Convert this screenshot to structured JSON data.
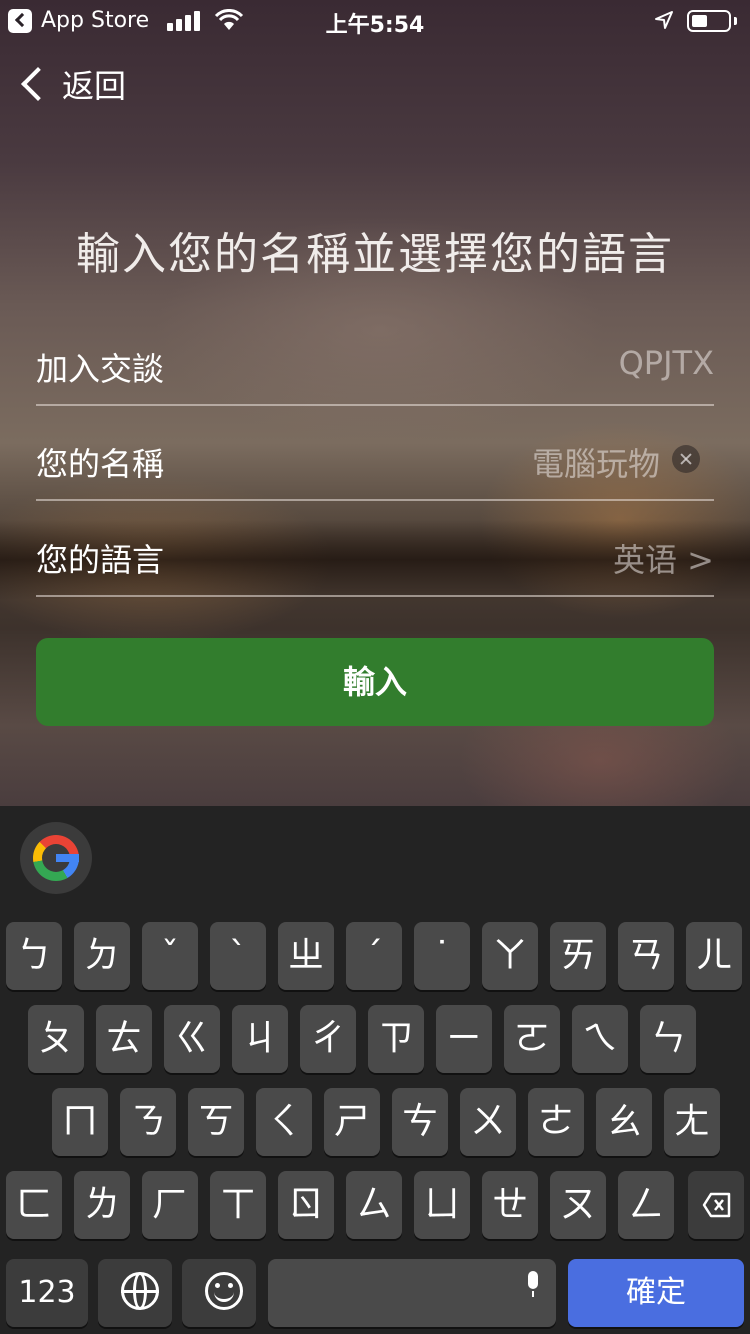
{
  "status_bar": {
    "back_app": "App Store",
    "time": "上午5:54",
    "icons": [
      "back-app-icon",
      "signal-icon",
      "wifi-icon",
      "location-icon",
      "battery-icon"
    ]
  },
  "nav": {
    "back_label": "返回"
  },
  "title": "輸入您的名稱並選擇您的語言",
  "form": {
    "join_label": "加入交談",
    "join_code": "QPJTX",
    "name_label": "您的名稱",
    "name_value": "電腦玩物",
    "language_label": "您的語言",
    "language_value": "英语 >"
  },
  "submit_label": "輸入",
  "colors": {
    "accent_green": "#327d2d",
    "confirm_blue": "#4a6ee0",
    "keyboard_bg": "#232323",
    "key_bg": "#4a4a4a"
  },
  "keyboard": {
    "row1": [
      "ㄅ",
      "ㄉ",
      "ˇ",
      "ˋ",
      "ㄓ",
      "ˊ",
      "˙",
      "ㄚ",
      "ㄞ",
      "ㄢ",
      "ㄦ"
    ],
    "row2": [
      "ㄆ",
      "ㄊ",
      "ㄍ",
      "ㄐ",
      "ㄔ",
      "ㄗ",
      "ㄧ",
      "ㄛ",
      "ㄟ",
      "ㄣ"
    ],
    "row3": [
      "ㄇ",
      "ㄋ",
      "ㄎ",
      "ㄑ",
      "ㄕ",
      "ㄘ",
      "ㄨ",
      "ㄜ",
      "ㄠ",
      "ㄤ"
    ],
    "row4": [
      "ㄈ",
      "ㄌ",
      "ㄏ",
      "ㄒ",
      "ㄖ",
      "ㄙ",
      "ㄩ",
      "ㄝ",
      "ㄡ",
      "ㄥ"
    ],
    "numbers_label": "123",
    "confirm_label": "確定"
  }
}
